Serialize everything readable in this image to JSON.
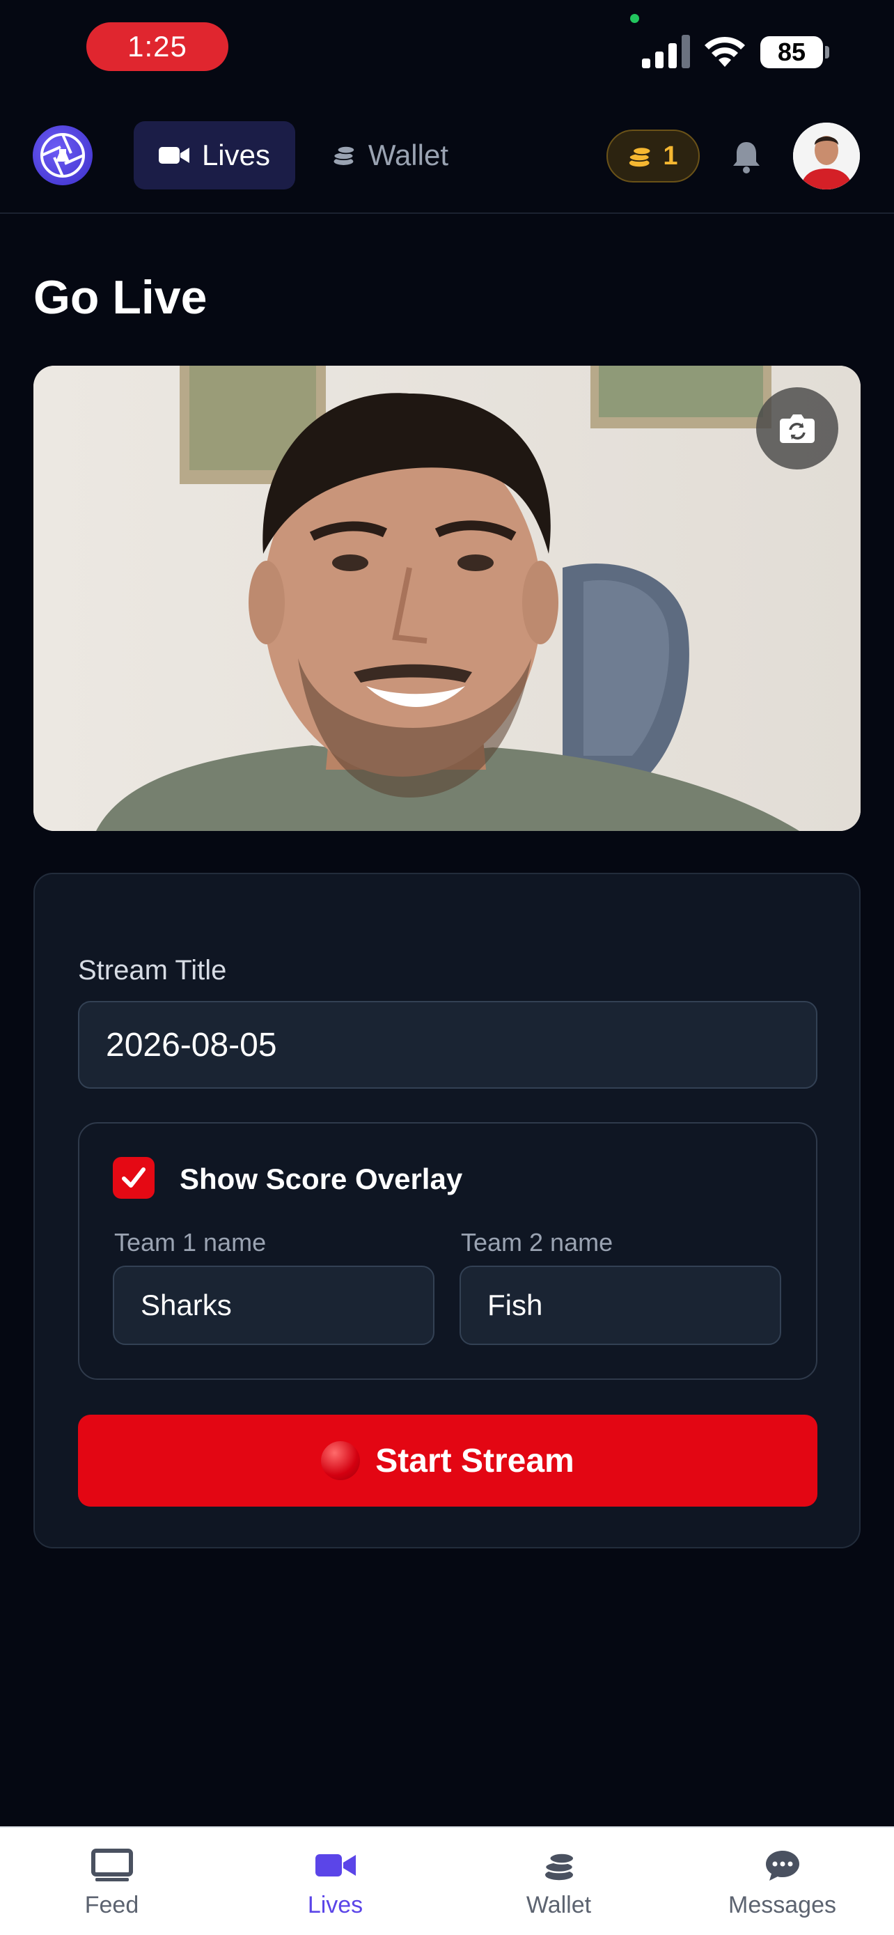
{
  "status_bar": {
    "time": "1:25",
    "battery": "85"
  },
  "top_nav": {
    "tabs": [
      {
        "label": "Lives",
        "icon": "video-icon",
        "active": true
      },
      {
        "label": "Wallet",
        "icon": "coins-icon",
        "active": false
      }
    ],
    "coin_count": "1",
    "coin_color": "#f5b731",
    "accent_color": "#5b45e8"
  },
  "page": {
    "title": "Go Live"
  },
  "form": {
    "stream_title_label": "Stream Title",
    "stream_title_value": "2026-08-05",
    "score_overlay_label": "Show Score Overlay",
    "score_overlay_checked": true,
    "team1_label": "Team 1 name",
    "team1_value": "Sharks",
    "team2_label": "Team 2 name",
    "team2_value": "Fish",
    "start_button_label": "Start Stream",
    "start_button_color": "#e30613"
  },
  "bottom_tabs": [
    {
      "label": "Feed",
      "icon": "tv-icon",
      "active": false
    },
    {
      "label": "Lives",
      "icon": "video-icon",
      "active": true
    },
    {
      "label": "Wallet",
      "icon": "coins-icon",
      "active": false
    },
    {
      "label": "Messages",
      "icon": "chat-icon",
      "active": false
    }
  ]
}
